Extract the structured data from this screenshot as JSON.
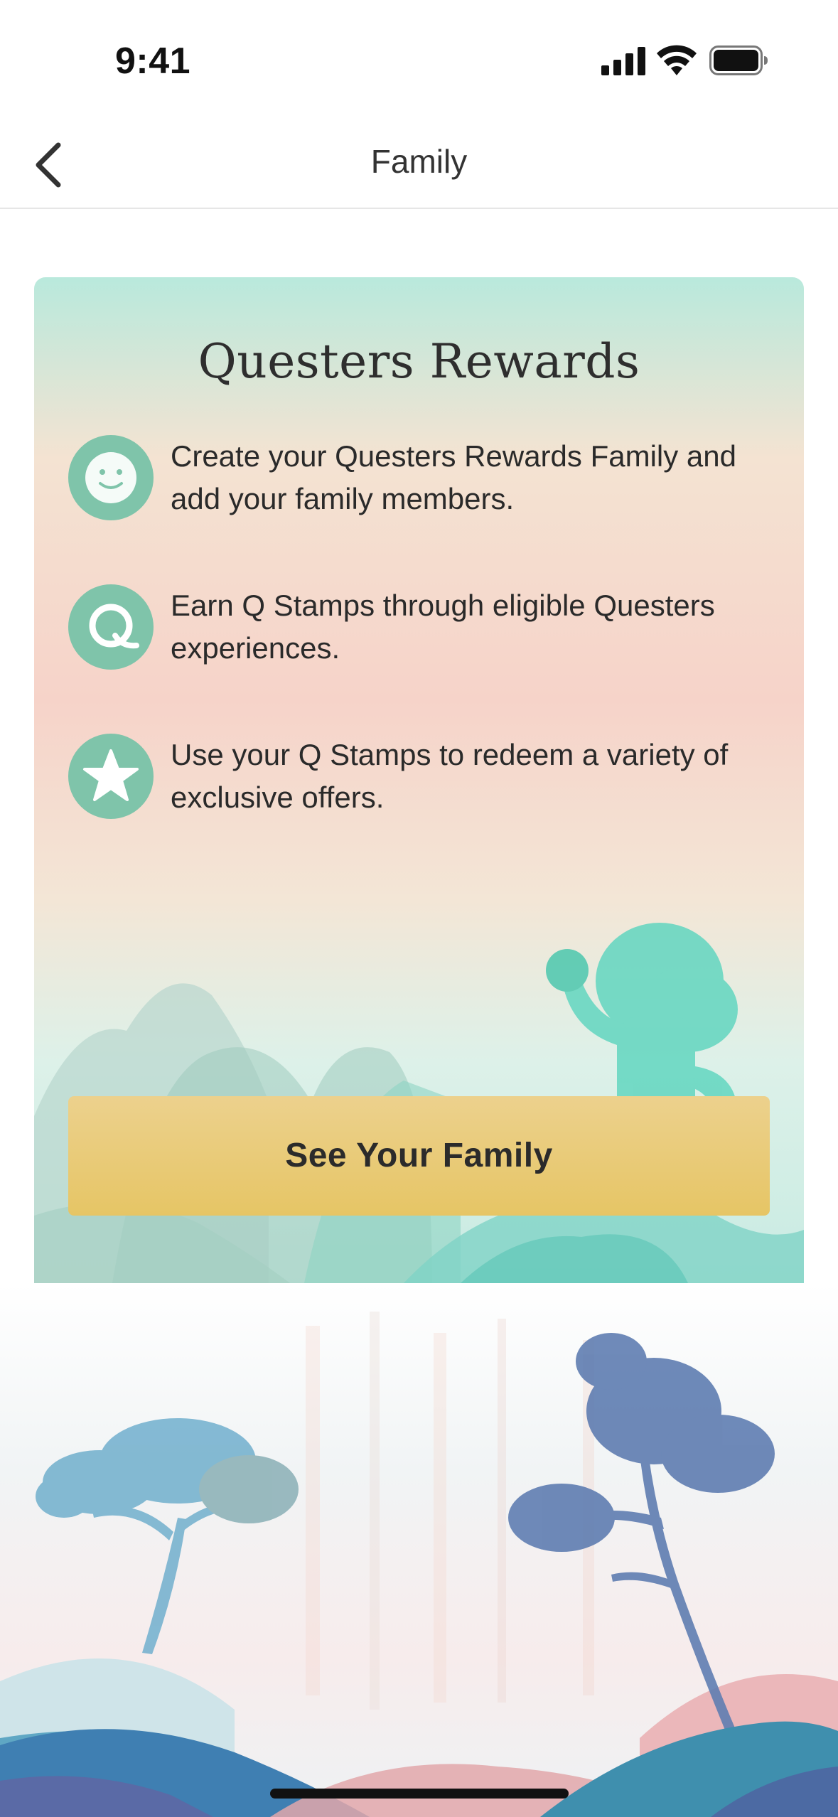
{
  "status_bar": {
    "time": "9:41"
  },
  "nav": {
    "title": "Family"
  },
  "card": {
    "title": "Questers Rewards",
    "items": [
      {
        "icon": "smiley-icon",
        "text": "Create your Questers Rewards Family and add your family members."
      },
      {
        "icon": "q-stamp-icon",
        "text": "Earn Q Stamps through eligible Questers experiences."
      },
      {
        "icon": "star-icon",
        "text": "Use your Q Stamps to redeem a variety of exclusive offers."
      }
    ],
    "cta_label": "See Your Family"
  },
  "colors": {
    "accent_teal": "#7fc4aa",
    "cta_gold": "#e8c96f",
    "text_dark": "#2b2b2b"
  }
}
